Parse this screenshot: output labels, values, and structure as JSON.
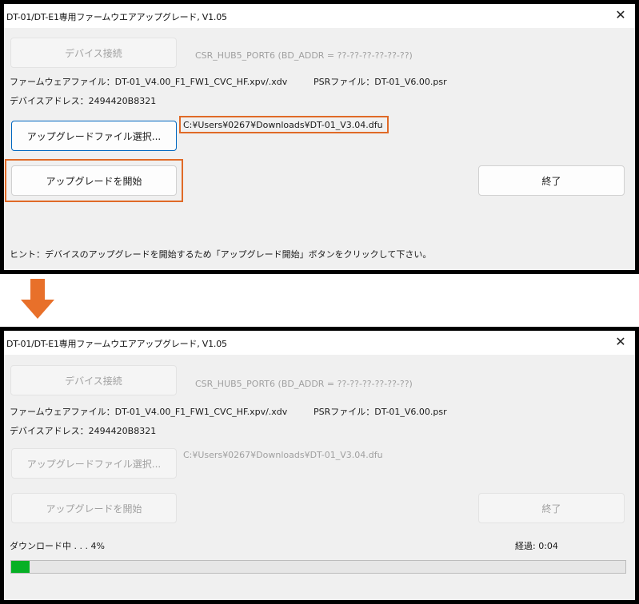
{
  "window_title": "DT-01/DT-E1専用ファームウエアアップグレード, V1.05",
  "close_glyph": "✕",
  "before": {
    "device_connect_button": "デバイス接続",
    "hub_info": "CSR_HUB5_PORT6 (BD_ADDR = ??-??-??-??-??-??)",
    "firmware_file": "ファームウェアファイル：DT-01_V4.00_F1_FW1_CVC_HF.xpv/.xdv",
    "psr_file": "PSRファイル：DT-01_V6.00.psr",
    "device_address": "デバイスアドレス：2494420B8321",
    "select_file_button": "アップグレードファイル選択...",
    "selected_file_path": "C:¥Users¥0267¥Downloads¥DT-01_V3.04.dfu",
    "start_upgrade_button": "アップグレードを開始",
    "exit_button": "終了",
    "hint": "ヒント：デバイスのアップグレードを開始するため「アップグレード開始」ボタンをクリックして下さい。"
  },
  "after": {
    "device_connect_button": "デバイス接続",
    "hub_info": "CSR_HUB5_PORT6 (BD_ADDR = ??-??-??-??-??-??)",
    "firmware_file": "ファームウェアファイル：DT-01_V4.00_F1_FW1_CVC_HF.xpv/.xdv",
    "psr_file": "PSRファイル：DT-01_V6.00.psr",
    "device_address": "デバイスアドレス：2494420B8321",
    "select_file_button": "アップグレードファイル選択...",
    "selected_file_path": "C:¥Users¥0267¥Downloads¥DT-01_V3.04.dfu",
    "start_upgrade_button": "アップグレードを開始",
    "exit_button": "終了",
    "download_status": "ダウンロード中 . . . 4%",
    "elapsed": "経過: 0:04",
    "progress_fraction": 0.03
  },
  "colors": {
    "highlight": "#e06a27",
    "arrow": "#e8702a",
    "progress_fill": "#06b025"
  }
}
